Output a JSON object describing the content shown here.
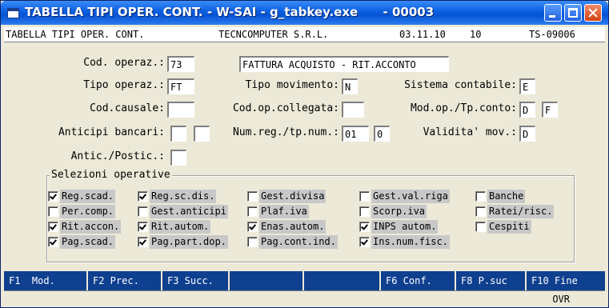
{
  "window": {
    "title": "TABELLA TIPI OPER. CONT. - W-SAI - g_tabkey.exe      - 00003"
  },
  "header": {
    "screen_name": "TABELLA TIPI OPER. CONT.",
    "company": "TECNCOMPUTER S.R.L.",
    "date": "03.11.10",
    "code": "10",
    "program": "TS-09006"
  },
  "form": {
    "cod_operaz": {
      "label": "Cod. operaz.:",
      "value": "73"
    },
    "description": {
      "value": "FATTURA ACQUISTO - RIT.ACCONTO"
    },
    "tipo_operaz": {
      "label": "Tipo operaz.:",
      "value": "FT"
    },
    "tipo_movimento": {
      "label": "Tipo movimento:",
      "value": "N"
    },
    "sistema_contabile": {
      "label": "Sistema contabile:",
      "value": "E"
    },
    "cod_causale": {
      "label": "Cod.causale:",
      "value": ""
    },
    "cod_op_collegata": {
      "label": "Cod.op.collegata:",
      "value": ""
    },
    "mod_op_tp_conto": {
      "label": "Mod.op./Tp.conto:",
      "value1": "D",
      "value2": "F"
    },
    "anticipi_bancari": {
      "label": "Anticipi bancari:",
      "value1": "",
      "value2": ""
    },
    "num_reg_tp_num": {
      "label": "Num.reg./tp.num.:",
      "value1": "01",
      "value2": "0"
    },
    "validita_mov": {
      "label": "Validita' mov.:",
      "value": "D"
    },
    "antic_postic": {
      "label": "Antic./Postic.:",
      "value": ""
    }
  },
  "selezioni": {
    "title": "Selezioni operative",
    "items": [
      {
        "label": "Reg.scad.",
        "checked": true
      },
      {
        "label": "Reg.sc.dis.",
        "checked": true
      },
      {
        "label": "Gest.divisa",
        "checked": false
      },
      {
        "label": "Gest.val.riga",
        "checked": false
      },
      {
        "label": "Banche",
        "checked": false
      },
      {
        "label": "Per.comp.",
        "checked": false
      },
      {
        "label": "Gest.anticipi",
        "checked": false
      },
      {
        "label": "Plaf.iva",
        "checked": false
      },
      {
        "label": "Scorp.iva",
        "checked": false
      },
      {
        "label": "Ratei/risc.",
        "checked": false
      },
      {
        "label": "Rit.accon.",
        "checked": true
      },
      {
        "label": "Rit.autom.",
        "checked": true
      },
      {
        "label": "Enas.autom.",
        "checked": true
      },
      {
        "label": "INPS autom.",
        "checked": true
      },
      {
        "label": "Cespiti",
        "checked": false
      },
      {
        "label": "Pag.scad.",
        "checked": true
      },
      {
        "label": "Pag.part.dop.",
        "checked": true
      },
      {
        "label": "Pag.cont.ind.",
        "checked": false
      },
      {
        "label": "Ins.num.fisc.",
        "checked": true
      }
    ]
  },
  "function_keys": [
    {
      "label": "F1  Mod."
    },
    {
      "label": "F2 Prec."
    },
    {
      "label": "F3 Succ."
    },
    {
      "label": ""
    },
    {
      "label": ""
    },
    {
      "label": "F6 Conf."
    },
    {
      "label": "F8 P.suc"
    },
    {
      "label": "F10 Fine"
    }
  ],
  "status": {
    "mode": "OVR"
  }
}
